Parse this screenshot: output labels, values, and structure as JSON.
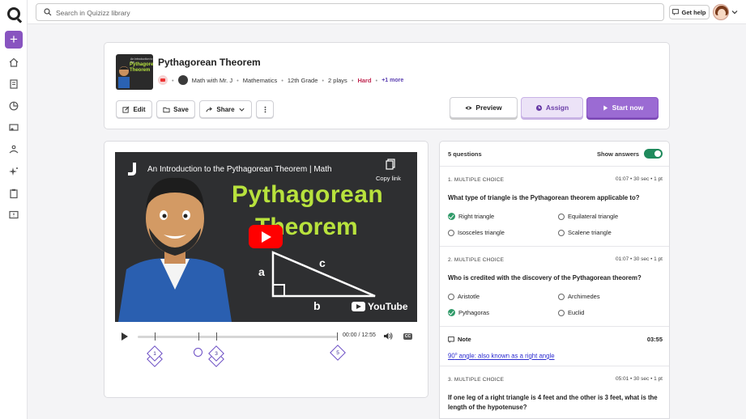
{
  "search": {
    "placeholder": "Search in Quizizz library"
  },
  "topbar": {
    "help_label": "Get help"
  },
  "quiz": {
    "title": "Pythagorean Theorem",
    "author": "Math with Mr. J",
    "subject": "Mathematics",
    "grade": "12th Grade",
    "plays": "2 plays",
    "difficulty": "Hard",
    "more": "+1 more",
    "thumb_line1": "An Introduction to the",
    "thumb_line2": "Pythagorean Theorem"
  },
  "actions": {
    "edit": "Edit",
    "save": "Save",
    "share": "Share",
    "preview": "Preview",
    "assign": "Assign",
    "start": "Start now"
  },
  "video": {
    "title": "An Introduction to the Pythagorean Theorem | Math",
    "copy_link": "Copy link",
    "headline1": "Pythagorean",
    "headline2": "Theorem",
    "label_a": "a",
    "label_b": "b",
    "label_c": "c",
    "brand": "YouTube",
    "time": "00:00 / 12:55",
    "markers": [
      "1",
      "3",
      "5"
    ]
  },
  "questions": {
    "count_label": "5 questions",
    "show_answers_label": "Show answers",
    "items": [
      {
        "type": "1. MULTIPLE CHOICE",
        "meta": "01:07  •  30 sec  •  1 pt",
        "text": "What type of triangle is the Pythagorean theorem applicable to?",
        "options": [
          "Right triangle",
          "Equilateral triangle",
          "Isosceles triangle",
          "Scalene triangle"
        ],
        "correct": 0
      },
      {
        "type": "2. MULTIPLE CHOICE",
        "meta": "01:07  •  30 sec  •  1 pt",
        "text": "Who is credited with the discovery of the Pythagorean theorem?",
        "options": [
          "Aristotle",
          "Archimedes",
          "Pythagoras",
          "Euclid"
        ],
        "correct": 2
      },
      {
        "type": "3. MULTIPLE CHOICE",
        "meta": "05:01  •  30 sec  •  1 pt",
        "text": "If one leg of a right triangle is 4 feet and the other is 3 feet, what is the length of the hypotenuse?"
      }
    ],
    "note": {
      "label": "Note",
      "time": "03:55",
      "text_num": "90",
      "text_sup": "o",
      "text_rest": " angle: also known as a right angle"
    }
  },
  "icons": {
    "rail": [
      "home-icon",
      "library-icon",
      "reports-icon",
      "classes-icon",
      "accommodations-icon",
      "ai-icon",
      "clipboard-icon",
      "feedback-icon"
    ]
  },
  "colors": {
    "primary": "#8854c0",
    "hard": "#c02650",
    "correct": "#2f9a68",
    "toggle": "#1f8a5c"
  }
}
